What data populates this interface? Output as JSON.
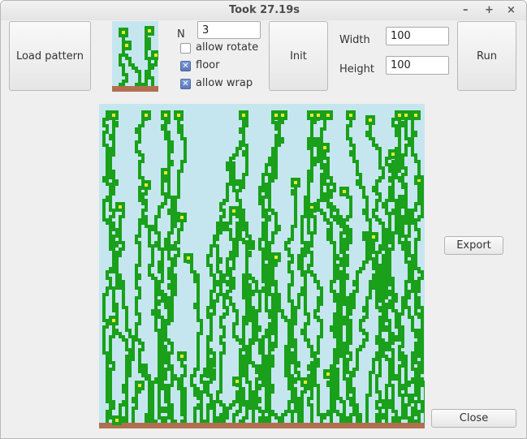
{
  "window": {
    "title": "Took 27.19s",
    "controls": {
      "minimize": "–",
      "maximize": "+",
      "close": "×"
    }
  },
  "toolbar": {
    "load_label": "Load pattern",
    "n_label": "N",
    "n_value": "3",
    "allow_rotate": {
      "label": "allow rotate",
      "checked": false
    },
    "floor": {
      "label": "floor",
      "checked": true
    },
    "allow_wrap": {
      "label": "allow wrap",
      "checked": true
    },
    "init_label": "Init",
    "width_label": "Width",
    "width_value": "100",
    "height_label": "Height",
    "height_value": "100",
    "run_label": "Run"
  },
  "side": {
    "export_label": "Export",
    "close_label": "Close"
  },
  "colors": {
    "sky": "#c5e6ef",
    "stem": "#1aa01a",
    "flower": "#e8e832",
    "ground": "#b07050"
  },
  "icons": {
    "checkbox_checked": "checkmark-icon"
  }
}
